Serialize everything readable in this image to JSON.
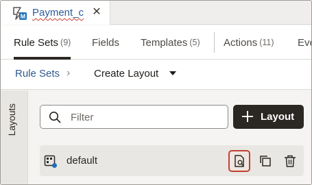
{
  "document_tab": {
    "title": "Payment_c",
    "close_glyph": "✕",
    "icon": "app-badge-icon"
  },
  "nav_tabs": [
    {
      "label": "Rule Sets",
      "count": "(9)",
      "active": true
    },
    {
      "label": "Fields",
      "count": "",
      "active": false
    },
    {
      "label": "Templates",
      "count": "(5)",
      "active": false
    },
    {
      "label": "Actions",
      "count": "(11)",
      "active": false
    },
    {
      "label": "Eve",
      "count": "",
      "active": false
    }
  ],
  "breadcrumb": {
    "parent": "Rule Sets",
    "separator": "›",
    "current": "Create Layout"
  },
  "side_tab": {
    "label": "Layouts"
  },
  "filter": {
    "placeholder": "Filter",
    "value": ""
  },
  "add_button": {
    "label": "Layout",
    "icon": "plus-icon"
  },
  "layouts": [
    {
      "name": "default",
      "icon": "layout-grid-icon",
      "actions": [
        "preview-icon",
        "duplicate-icon",
        "delete-icon"
      ]
    }
  ],
  "colors": {
    "accent_dark": "#2b2722",
    "link": "#2d5a90",
    "highlight_border": "#c2412f"
  }
}
